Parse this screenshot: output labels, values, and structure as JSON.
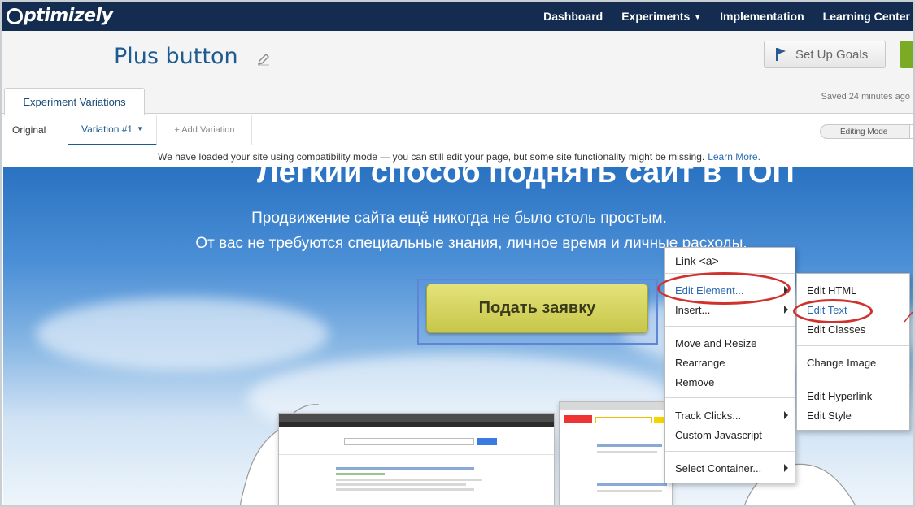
{
  "brand": {
    "name": "ptimizely"
  },
  "nav": {
    "items": [
      {
        "label": "Dashboard",
        "dropdown": false
      },
      {
        "label": "Experiments",
        "dropdown": true
      },
      {
        "label": "Implementation",
        "dropdown": false
      },
      {
        "label": "Learning Center",
        "dropdown": false
      }
    ]
  },
  "experiment": {
    "title": "Plus button"
  },
  "toolbar": {
    "goals_label": "Set Up Goals"
  },
  "tabs": {
    "main": "Experiment Variations",
    "saved": "Saved 24 minutes ago"
  },
  "variations": {
    "original": "Original",
    "active": "Variation #1",
    "add": "+ Add Variation",
    "mode": "Editing Mode"
  },
  "notice": {
    "text": "We have loaded your site using compatibility mode — you can still edit your page, but some site functionality might be missing.",
    "link": "Learn More."
  },
  "site": {
    "title": "Легкий способ поднять сайт в ТОП",
    "line1": "Продвижение сайта ещё никогда не было столь простым.",
    "line2": "От вас не требуются специальные знания, личное время и личные расходы.",
    "cta": "Подать заявку"
  },
  "menu": {
    "header": "Link <a>",
    "items": [
      {
        "label": "Edit Element...",
        "submenu": true
      },
      {
        "label": "Insert...",
        "submenu": true
      },
      {
        "label": "Move and Resize",
        "submenu": false
      },
      {
        "label": "Rearrange",
        "submenu": false
      },
      {
        "label": "Remove",
        "submenu": false
      },
      {
        "label": "Track Clicks...",
        "submenu": true
      },
      {
        "label": "Custom Javascript",
        "submenu": false
      },
      {
        "label": "Select Container...",
        "submenu": true
      }
    ]
  },
  "submenu": {
    "items": [
      "Edit HTML",
      "Edit Text",
      "Edit Classes",
      "Change Image",
      "Edit Hyperlink",
      "Edit Style"
    ]
  },
  "colors": {
    "nav_bg": "#132c4f",
    "title": "#1d5b91",
    "accent_green": "#7bab24",
    "highlight_ring": "#d0312d",
    "link": "#2a6ab0"
  }
}
